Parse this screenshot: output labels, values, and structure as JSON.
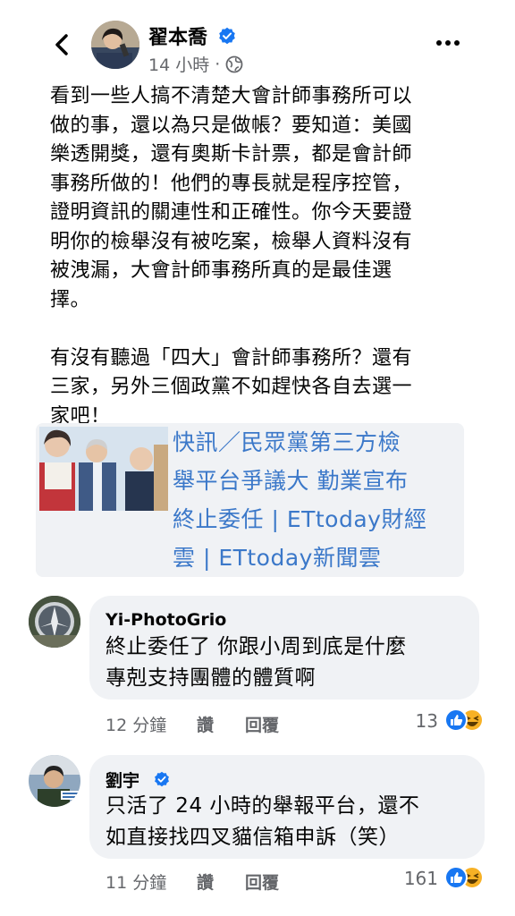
{
  "post": {
    "author": "翟本喬",
    "time": "14 小時",
    "text": "看到一些人搞不清楚大會計師事務所可以\n做的事，還以為只是做帳？要知道：美國\n樂透開獎，還有奧斯卡計票，都是會計師\n事務所做的！他們的專長就是程序控管，\n證明資訊的關連性和正確性。你今天要證\n明你的檢舉沒有被吃案，檢舉人資料沒有\n被洩漏，大會計師事務所真的是最佳選\n擇。\n\n有沒有聽過「四大」會計師事務所？還有\n三家，另外三個政黨不如趕快各自去選一\n家吧！"
  },
  "link_preview": {
    "title": "快訊／民眾黨第三方檢\n舉平台爭議大 勤業宣布\n終止委任 | ETtoday財經\n雲 | ETtoday新聞雲"
  },
  "comments": [
    {
      "author": "Yi-PhotoGrio",
      "text": "終止委任了 你跟小周到底是什麼\n專剋支持團體的體質啊",
      "time": "12 分鐘",
      "like_label": "讚",
      "reply_label": "回覆",
      "reaction_count": "13"
    },
    {
      "author": "劉宇",
      "text": "只活了 24 小時的舉報平台，還不\n如直接找四叉貓信箱申訴（笑）",
      "time": "11 分鐘",
      "like_label": "讚",
      "reply_label": "回覆",
      "reaction_count": "161"
    }
  ],
  "colors": {
    "link": "#3b78c9",
    "verified": "#1877f2",
    "muted": "#65676b",
    "bubble": "#f0f2f5"
  },
  "icons": [
    "back-arrow-icon",
    "verified-badge-icon",
    "globe-icon",
    "more-options-icon",
    "like-reaction-icon",
    "haha-reaction-icon"
  ]
}
